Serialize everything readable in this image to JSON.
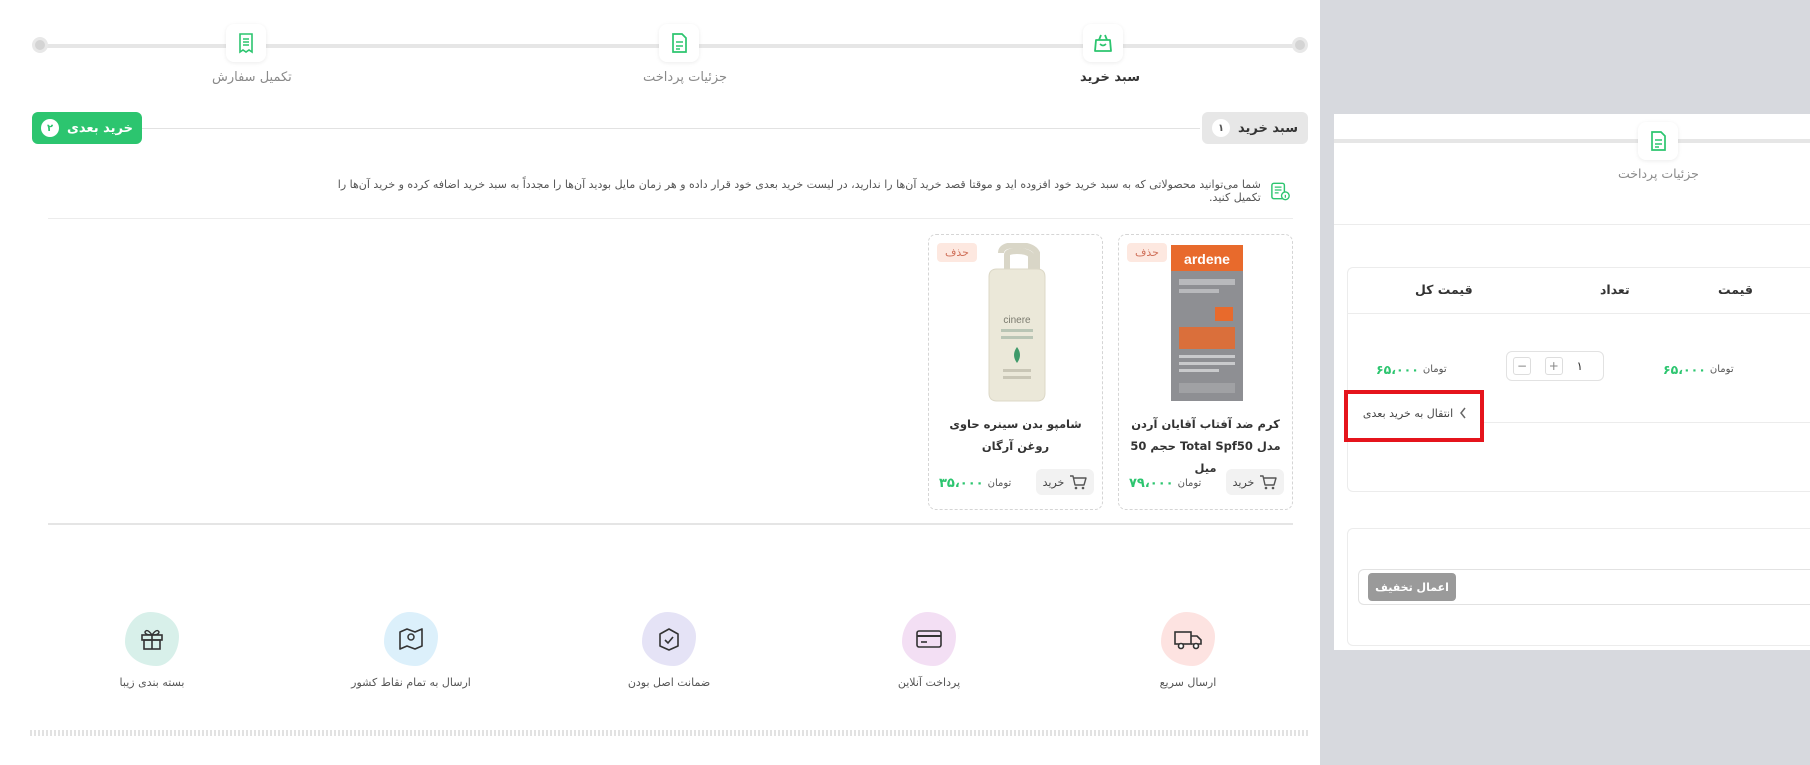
{
  "stepper": {
    "steps": [
      {
        "label": "سبد خرید",
        "active": true
      },
      {
        "label": "جزئیات پرداخت",
        "active": false
      },
      {
        "label": "تکمیل سفارش",
        "active": false
      }
    ]
  },
  "tabs": {
    "cart": {
      "label": "سبد خرید",
      "count": "۱"
    },
    "next": {
      "label": "خرید بعدی",
      "count": "۲"
    }
  },
  "info_text": "شما می‌توانید محصولاتی که به سبد خرید خود افزوده اید و موقتا قصد خرید آن‌ها را ندارید، در لیست خرید بعدی خود قرار داده و هر زمان مایل بودید آن‌ها را مجدداً به سبد خرید اضافه کرده و خرید آن‌ها را تکمیل کنید.",
  "products": [
    {
      "delete_label": "حذف",
      "title": "کرم ضد آفتاب آقایان آردن مدل Total Spf50 حجم 50 میل",
      "brand": "ardene",
      "buy_label": "خرید",
      "price": "۷۹،۰۰۰",
      "currency": "تومان"
    },
    {
      "delete_label": "حذف",
      "title": "شامپو بدن سینره حاوی روغن آرگان",
      "brand": "cinere",
      "buy_label": "خرید",
      "price": "۳۵،۰۰۰",
      "currency": "تومان"
    }
  ],
  "features": [
    {
      "label": "ارسال سریع",
      "icon": "truck-icon",
      "color": "#fde3e1"
    },
    {
      "label": "پرداخت آنلاین",
      "icon": "credit-card-icon",
      "color": "#f3dff4"
    },
    {
      "label": "ضمانت اصل بودن",
      "icon": "box-check-icon",
      "color": "#e5e3f6"
    },
    {
      "label": "ارسال به تمام نقاط کشور",
      "icon": "map-icon",
      "color": "#dcf0fb"
    },
    {
      "label": "بسته بندی زیبا",
      "icon": "gift-icon",
      "color": "#d8f0ea"
    }
  ],
  "overlay": {
    "step_label": "جزئیات پرداخت",
    "table": {
      "headers": {
        "price": "قیمت",
        "qty": "تعداد",
        "total": "قیمت کل"
      },
      "row": {
        "price": "۶۵،۰۰۰",
        "qty": "۱",
        "total": "۶۵،۰۰۰",
        "currency": "تومان"
      }
    },
    "move_to_next_label": "انتقال به خرید بعدی",
    "discount_button": "اعمال تخفیف"
  },
  "colors": {
    "accent": "#2cc56f",
    "highlight": "#e5141c"
  }
}
